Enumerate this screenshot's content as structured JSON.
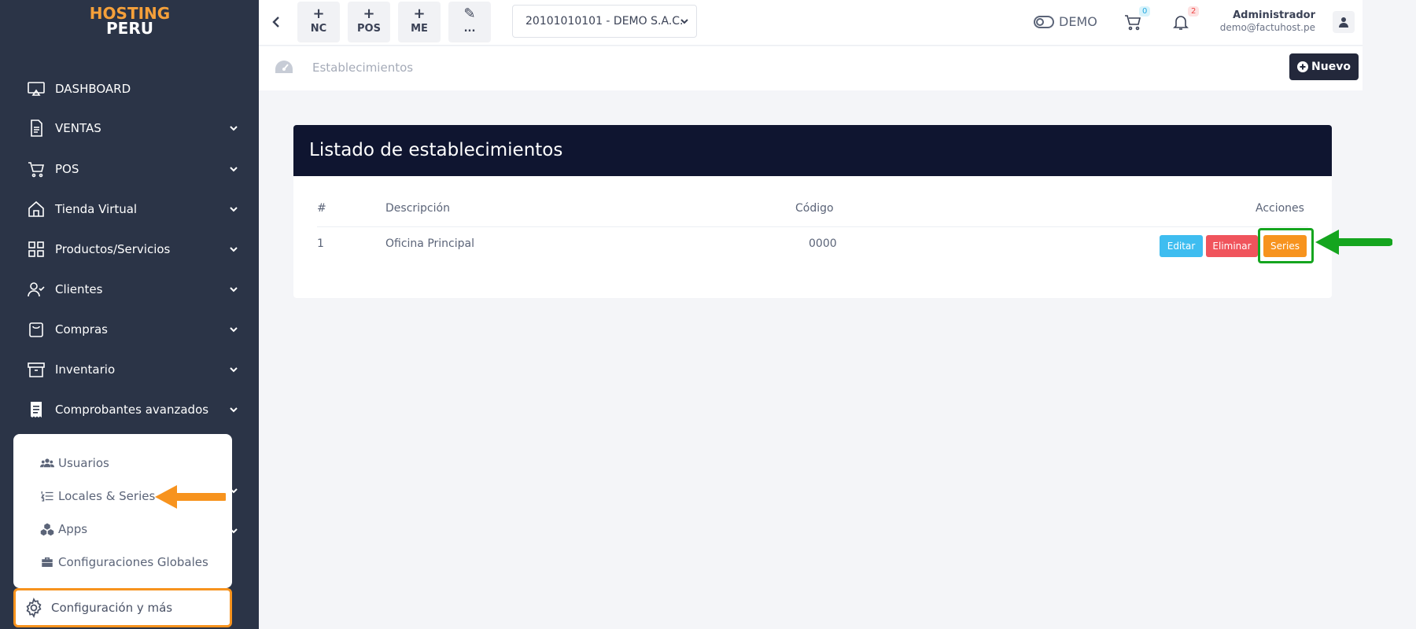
{
  "logo": {
    "line1": "HOSTING",
    "line2": "PERU"
  },
  "sidebar": {
    "items": [
      {
        "label": "DASHBOARD",
        "icon": "monitor-icon"
      },
      {
        "label": "VENTAS",
        "icon": "document-icon"
      },
      {
        "label": "POS",
        "icon": "cart-icon"
      },
      {
        "label": "Tienda Virtual",
        "icon": "home-icon"
      },
      {
        "label": "Productos/Servicios",
        "icon": "grid-icon"
      },
      {
        "label": "Clientes",
        "icon": "user-check-icon"
      },
      {
        "label": "Compras",
        "icon": "shopping-bag-icon"
      },
      {
        "label": "Inventario",
        "icon": "archive-icon"
      },
      {
        "label": "Comprobantes avanzados",
        "icon": "receipt-icon"
      }
    ],
    "submenu": [
      {
        "label": "Usuarios",
        "icon": "users-icon"
      },
      {
        "label": "Locales & Series",
        "icon": "list-icon"
      },
      {
        "label": "Apps",
        "icon": "cubes-icon"
      },
      {
        "label": "Configuraciones Globales",
        "icon": "toolbox-icon"
      }
    ],
    "config_label": "Configuración y más"
  },
  "topbar": {
    "quick": [
      {
        "label": "NC",
        "symbol": "+"
      },
      {
        "label": "POS",
        "symbol": "+"
      },
      {
        "label": "ME",
        "symbol": "+"
      },
      {
        "label": "...",
        "symbol": "✎"
      }
    ],
    "company": "20101010101 - DEMO S.A.C.",
    "demo_label": "DEMO",
    "cart_count": "0",
    "notif_count": "2",
    "user_name": "Administrador",
    "user_email": "demo@factuhost.pe"
  },
  "breadcrumb": {
    "text": "Establecimientos",
    "new_label": "Nuevo"
  },
  "card": {
    "title": "Listado de establecimientos",
    "columns": [
      "#",
      "Descripción",
      "Código",
      "Acciones"
    ],
    "rows": [
      {
        "num": "1",
        "description": "Oficina Principal",
        "code": "0000"
      }
    ],
    "actions": {
      "edit": "Editar",
      "delete": "Eliminar",
      "series": "Series"
    }
  },
  "colors": {
    "sidebar_bg": "#2b3447",
    "header_bg": "#0f1530",
    "edit": "#3ebdf0",
    "delete": "#f0545c",
    "series": "#f7931e",
    "highlight_orange": "#f7931e",
    "highlight_green": "#15a51f"
  }
}
